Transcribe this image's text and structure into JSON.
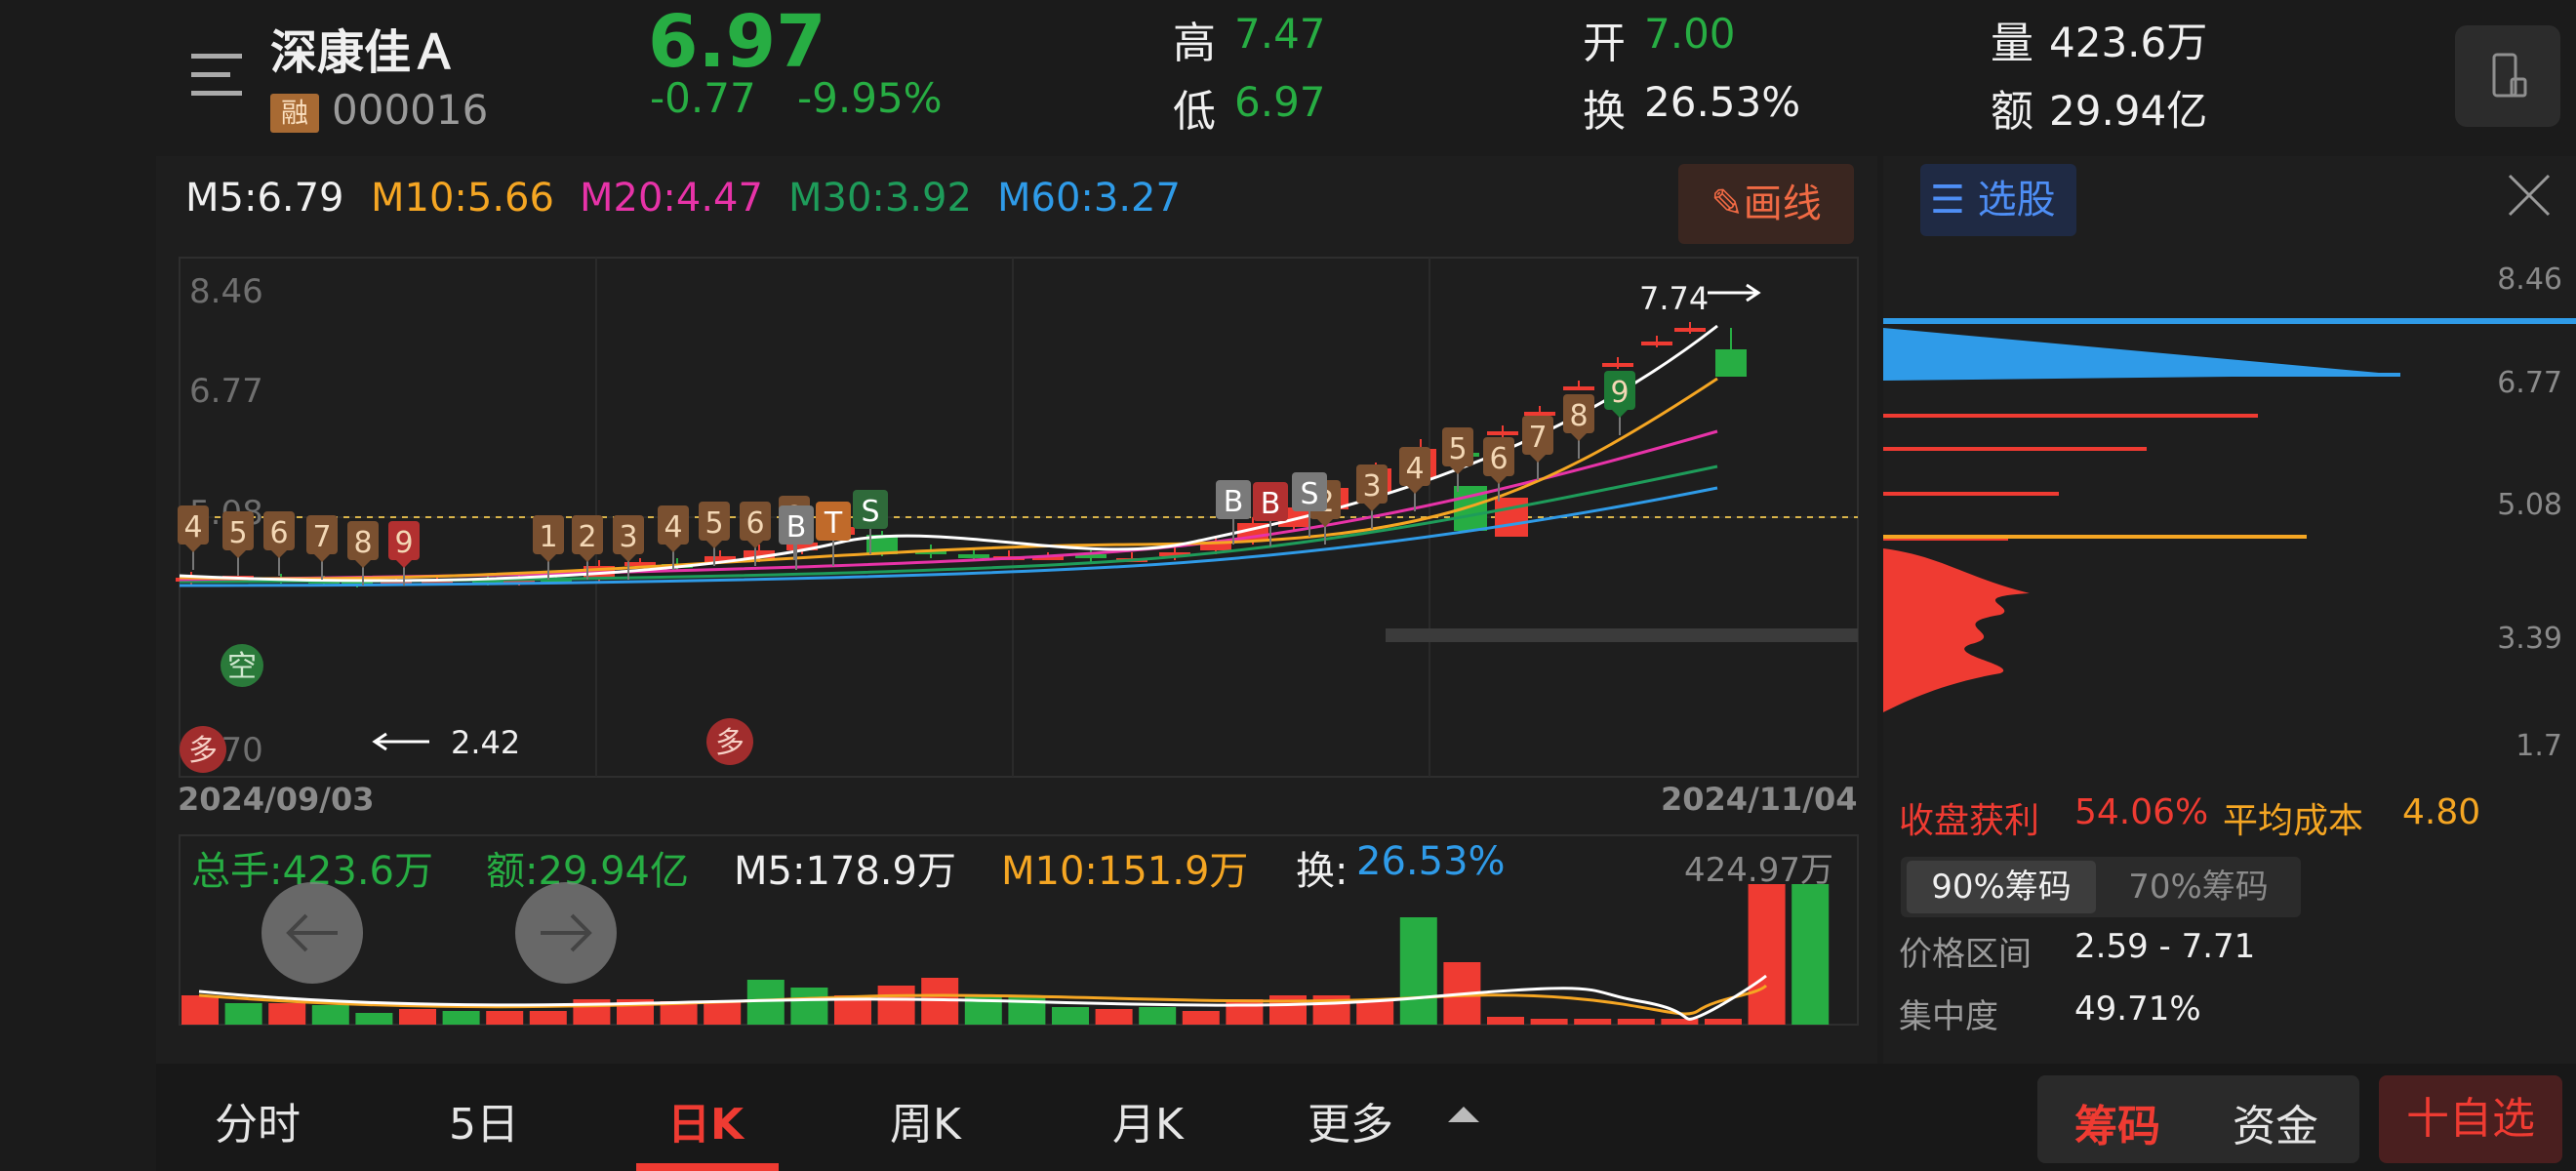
{
  "header": {
    "name": "深康佳Ａ",
    "tag": "融",
    "code": "000016",
    "price": "6.97",
    "change": "-0.77",
    "change_pct": "-9.95%",
    "high_label": "高",
    "high": "7.47",
    "low_label": "低",
    "low": "6.97",
    "open_label": "开",
    "open": "7.00",
    "turnover_label": "换",
    "turnover": "26.53%",
    "volume_label": "量",
    "volume": "423.6万",
    "amount_label": "额",
    "amount": "29.94亿"
  },
  "ma": {
    "m5": "M5:6.79",
    "m10": "M10:5.66",
    "m20": "M20:4.47",
    "m30": "M30:3.92",
    "m60": "M60:3.27"
  },
  "draw_button": "画线",
  "kline": {
    "y_labels": [
      "8.46",
      "6.77",
      "5.08",
      "1.70"
    ],
    "start_date": "2024/09/03",
    "end_date": "2024/11/04",
    "max_label": "7.74",
    "min_label": "2.42",
    "signal_duo": "多",
    "signal_kong": "空",
    "signal_b": "B",
    "signal_s": "S",
    "signal_t": "T",
    "colors": {
      "up": "#ef3b32",
      "down": "#27ad43",
      "m5": "#ffffff",
      "m10": "#f5a623",
      "m20": "#e733a8",
      "m30": "#1e9c5a",
      "m60": "#2f9be8"
    }
  },
  "volume_panel": {
    "total": "总手:423.6万",
    "amount": "额:29.94亿",
    "m5": "M5:178.9万",
    "m10": "M10:151.9万",
    "turn_label": "换:",
    "turn": "26.53%",
    "max": "424.97万"
  },
  "chips": {
    "pick_label": "选股",
    "y_labels": [
      "8.46",
      "6.77",
      "5.08",
      "3.39",
      "1.7"
    ],
    "profit_label": "收盘获利",
    "profit": "54.06%",
    "avg_label": "平均成本",
    "avg": "4.80",
    "tab90": "90%筹码",
    "tab70": "70%筹码",
    "range_label": "价格区间",
    "range": "2.59 - 7.71",
    "conc_label": "集中度",
    "conc": "49.71%"
  },
  "bottom": {
    "tabs": [
      "分时",
      "5日",
      "日K",
      "周K",
      "月K",
      "更多"
    ],
    "chip_btn": "筹码",
    "fund_btn": "资金",
    "add_btn": "十自选"
  }
}
